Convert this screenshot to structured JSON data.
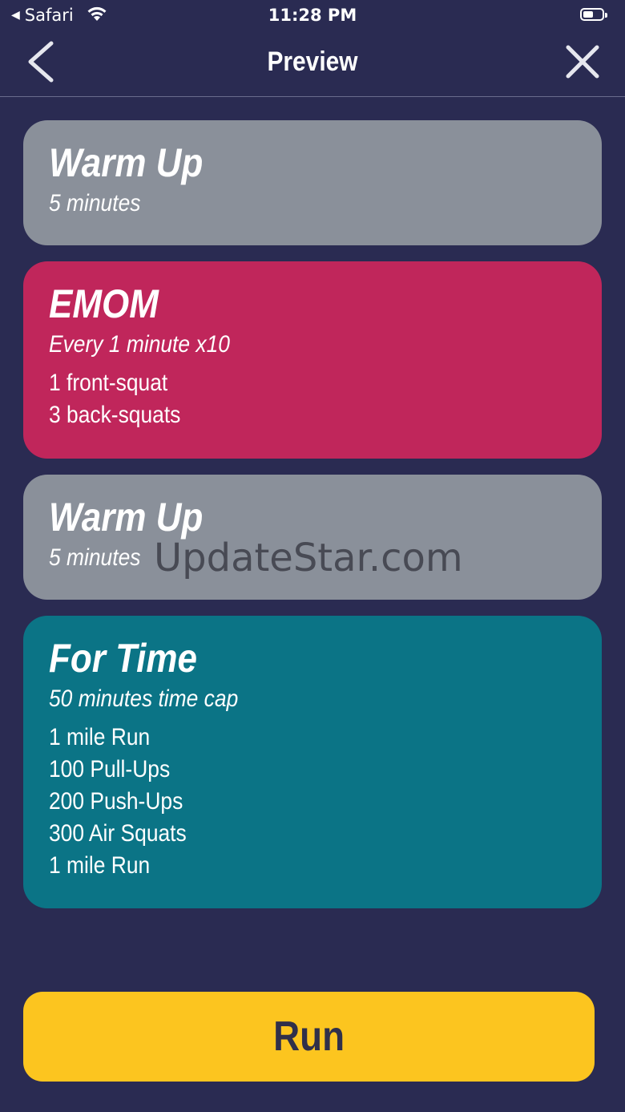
{
  "status_bar": {
    "back_app": "Safari",
    "time": "11:28 PM"
  },
  "nav": {
    "title": "Preview",
    "back_icon": "chevron-left-icon",
    "close_icon": "close-icon"
  },
  "cards": [
    {
      "title": "Warm Up",
      "subtitle": "5 minutes",
      "lines": [],
      "color": "#8a909a"
    },
    {
      "title": "EMOM",
      "subtitle": "Every 1 minute x10",
      "lines": [
        "1 front-squat",
        "3 back-squats"
      ],
      "color": "#c0265b"
    },
    {
      "title": "Warm Up",
      "subtitle": "5 minutes",
      "lines": [],
      "color": "#8a909a"
    },
    {
      "title": "For Time",
      "subtitle": "50 minutes time cap",
      "lines": [
        "1 mile Run",
        "100 Pull-Ups",
        "200 Push-Ups",
        "300 Air Squats",
        "1 mile Run"
      ],
      "color": "#0b7486"
    }
  ],
  "watermark": "UpdateStar.com",
  "run_button": {
    "label": "Run",
    "color": "#fcc51f"
  },
  "colors": {
    "background": "#2a2b52"
  }
}
